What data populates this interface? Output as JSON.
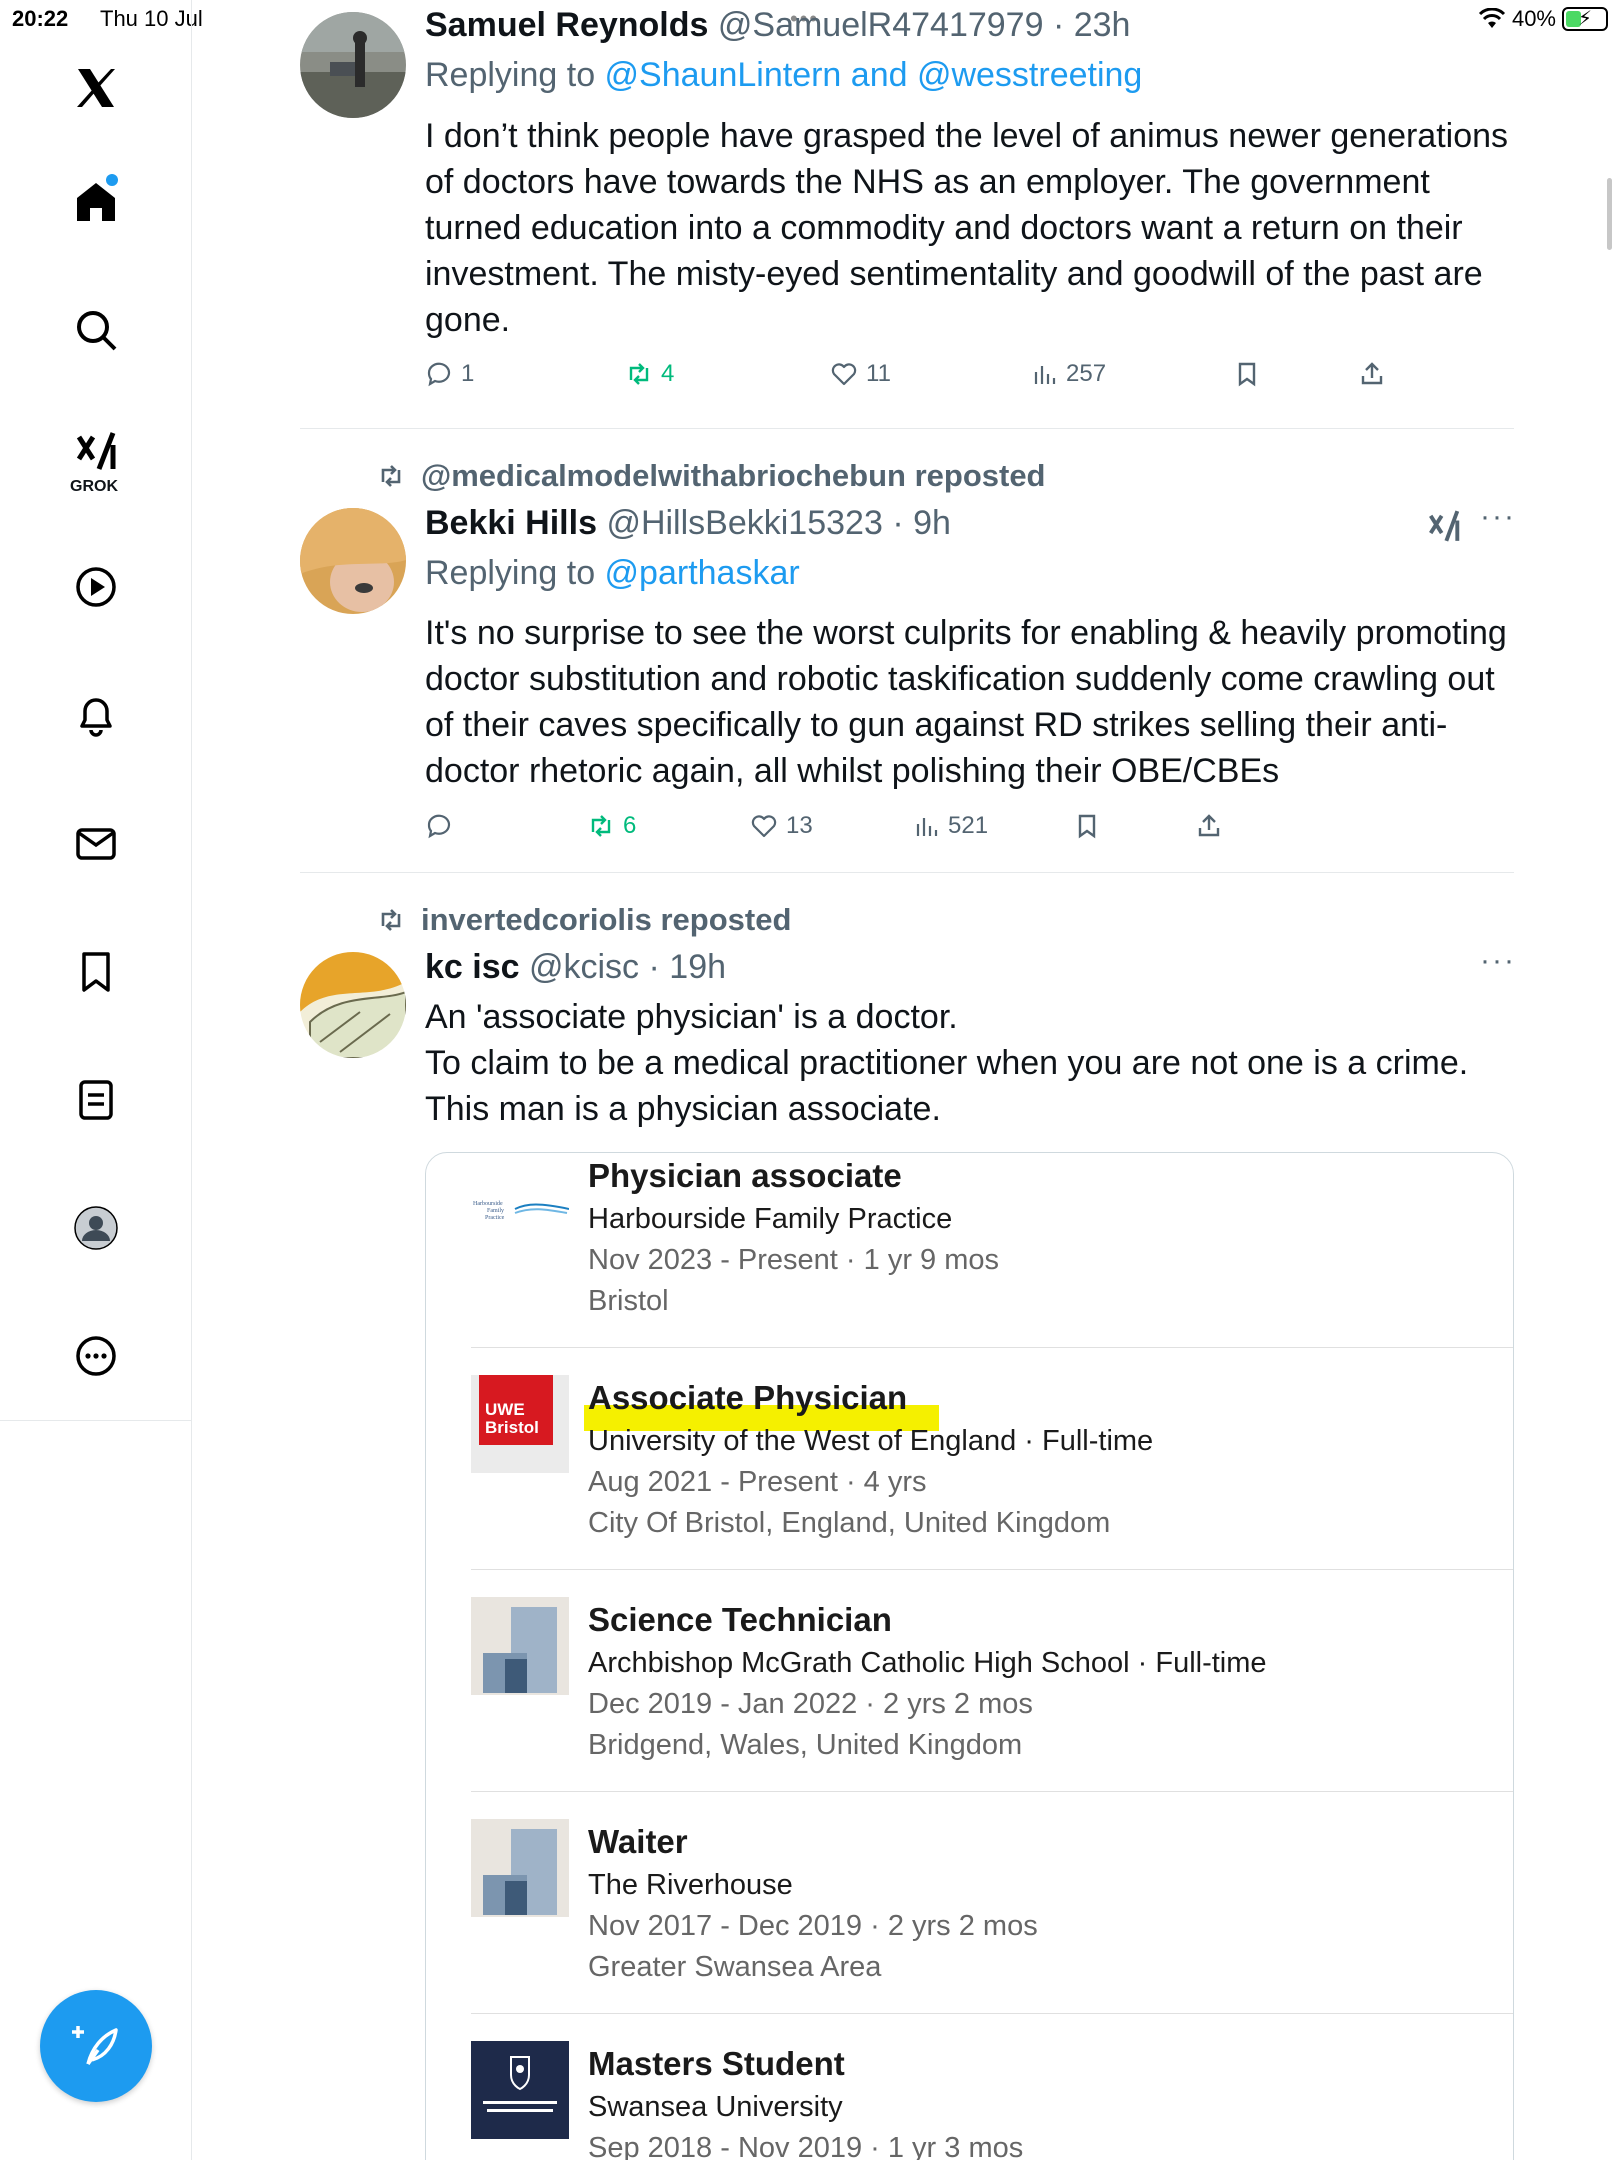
{
  "status_bar": {
    "time": "20:22",
    "date": "Thu 10 Jul",
    "battery": "40%"
  },
  "sidebar": {
    "grok_label": "GROK",
    "items": [
      "x-logo",
      "home",
      "search",
      "grok",
      "videos",
      "notifications",
      "messages",
      "bookmarks",
      "lists",
      "profile",
      "more"
    ]
  },
  "tweets": [
    {
      "name": "Samuel Reynolds",
      "handle": "@SamuelR47417979",
      "time": "· 23h",
      "replying_prefix": "Replying to ",
      "replying_to": "@ShaunLintern and @wesstreeting",
      "text": "I don’t think people have grasped the level of animus newer generations of doctors have towards the NHS as an employer. The government turned education into a commodity and doctors want a return on their investment. The misty-eyed sentimentality and goodwill of the past are gone.",
      "replies": "1",
      "reposts": "4",
      "likes": "11",
      "views": "257"
    },
    {
      "repost_by": "@medicalmodelwithabriochebun reposted",
      "name": "Bekki Hills",
      "handle": "@HillsBekki15323",
      "time": "· 9h",
      "replying_prefix": "Replying to ",
      "replying_to": "@parthaskar",
      "text": "It's no surprise to see the worst culprits for enabling & heavily promoting doctor substitution and robotic taskification suddenly come crawling out of their caves specifically to gun against RD strikes selling their anti-doctor rhetoric again, all whilst polishing their OBE/CBEs",
      "replies": "",
      "reposts": "6",
      "likes": "13",
      "views": "521"
    },
    {
      "repost_by": "invertedcoriolis reposted",
      "name": "kc isc",
      "handle": "@kcisc",
      "time": "· 19h",
      "text_lines": [
        "An 'associate physician' is a doctor.",
        "To claim to be a medical practitioner when you are not one is a crime.",
        "This man is a physician associate."
      ]
    }
  ],
  "card_jobs": [
    {
      "title": "Physician associate",
      "org": "Harbourside Family Practice",
      "dates": "Nov 2023 - Present · 1 yr 9 mos",
      "location": "Bristol",
      "logo": "harbourside-logo"
    },
    {
      "title": "Associate Physician",
      "org": "University of the West of England · Full-time",
      "dates": "Aug 2021 - Present · 4 yrs",
      "location": "City Of Bristol, England, United Kingdom",
      "logo": "uwe-logo",
      "logo_text_1": "UWE",
      "logo_text_2": "Bristol"
    },
    {
      "title": "Science Technician",
      "org": "Archbishop McGrath Catholic High School · Full-time",
      "dates": "Dec 2019 - Jan 2022 · 2 yrs 2 mos",
      "location": "Bridgend, Wales, United Kingdom",
      "logo": "generic-company-logo"
    },
    {
      "title": "Waiter",
      "org": "The Riverhouse",
      "dates": "Nov 2017 - Dec 2019 · 2 yrs 2 mos",
      "location": "Greater Swansea Area",
      "logo": "generic-company-logo"
    },
    {
      "title": "Masters Student",
      "org": "Swansea University",
      "dates": "Sep 2018 - Nov 2019 · 1 yr 3 mos",
      "location": "",
      "logo": "swansea-logo"
    }
  ],
  "colors": {
    "accent": "#1d9bf0",
    "repost_green": "#00ba7c",
    "muted": "#536471",
    "highlight": "#f5f000",
    "uwe_red": "#d71920",
    "swansea_navy": "#1e2a4a"
  }
}
